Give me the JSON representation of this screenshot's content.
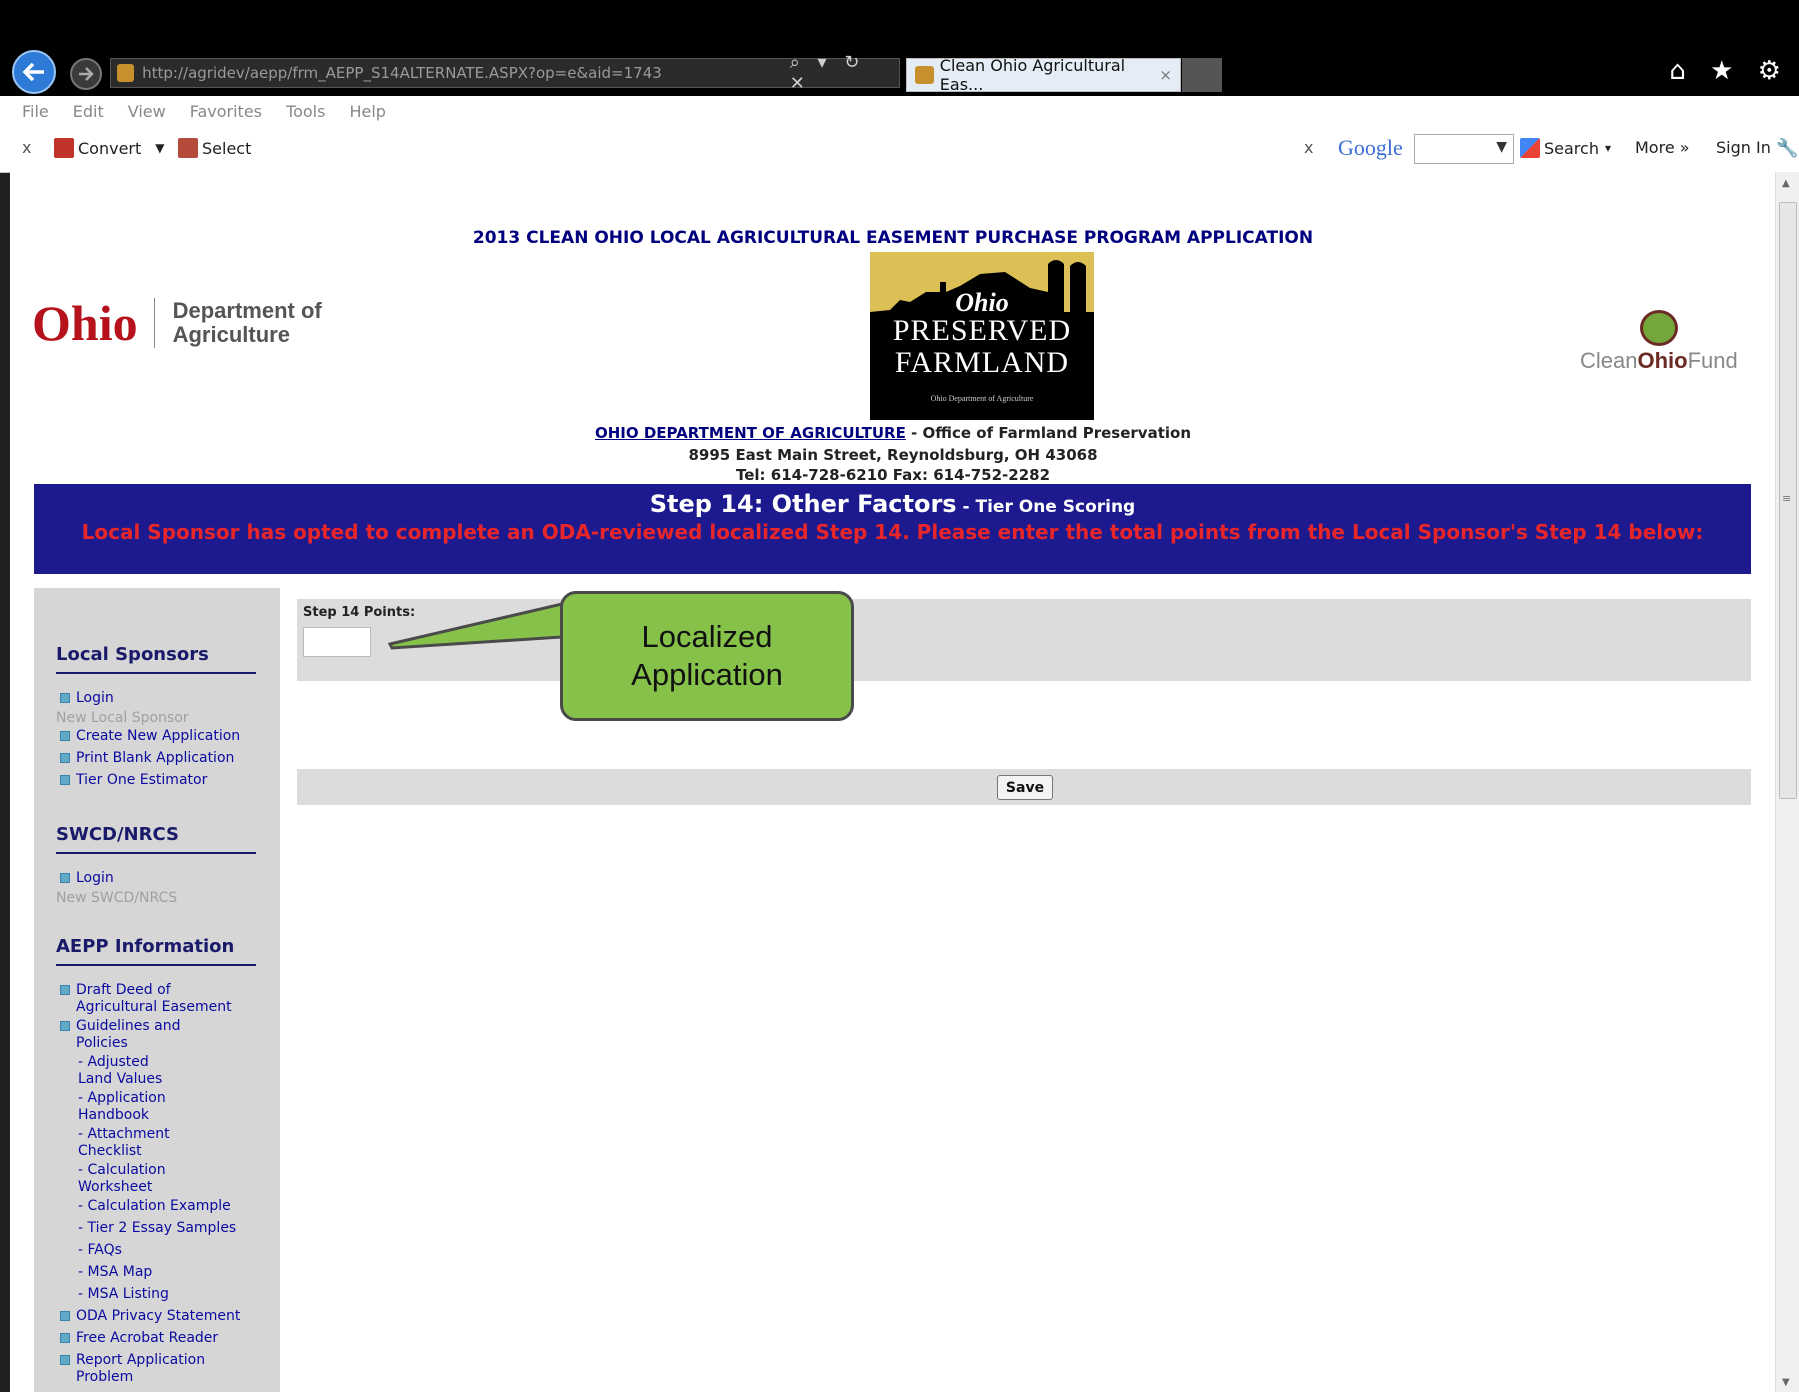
{
  "browser": {
    "url": "http://agridev/aepp/frm_AEPP_S14ALTERNATE.ASPX?op=e&aid=1743",
    "tab_title": "Clean Ohio Agricultural Eas...",
    "tab_close": "×",
    "address_controls": "⌕ ▾ ↻ ✕",
    "right_icons": "⌂ ★ ⚙",
    "menu": [
      "File",
      "Edit",
      "View",
      "Favorites",
      "Tools",
      "Help"
    ],
    "toolbar": {
      "close": "x",
      "convert_label": "Convert",
      "convert_arrow": "▼",
      "select_label": "Select",
      "google_close": "x",
      "google_label": "Google",
      "google_arrow": "▼",
      "search_label": "Search",
      "search_arrow": "▾",
      "more_label": "More »",
      "signin_label": "Sign In"
    }
  },
  "page": {
    "title": "2013 CLEAN OHIO LOCAL AGRICULTURAL EASEMENT PURCHASE PROGRAM APPLICATION",
    "oda_logo": {
      "ohio": "Ohio",
      "dept_line1": "Department of",
      "dept_line2": "Agriculture"
    },
    "farmland_logo": {
      "ohio": "Ohio",
      "line1": "PRESERVED",
      "line2": "FARMLAND",
      "small": "Ohio Department of Agriculture"
    },
    "cof_logo": {
      "clean": "Clean",
      "ohio": "Ohio",
      "fund": "Fund"
    },
    "office": {
      "link": "OHIO DEPARTMENT OF AGRICULTURE",
      "rest": " - Office of Farmland Preservation",
      "address": "8995 East Main Street, Reynoldsburg, OH  43068",
      "tel": "Tel: 614-728-6210 Fax: 614-752-2282"
    },
    "step": {
      "heading": "Step 14: Other Factors",
      "sub": " - Tier One Scoring",
      "message": "Local Sponsor has opted to complete an ODA-reviewed localized Step 14. Please enter the total points from the Local Sponsor's Step 14 below:"
    },
    "form": {
      "points_label": "Step 14 Points:",
      "points_value": "",
      "save": "Save"
    },
    "callout": {
      "line1": "Localized",
      "line2": "Application"
    }
  },
  "sidebar": {
    "local_sponsors": {
      "heading": "Local Sponsors",
      "login": "Login",
      "new_sponsor": "New Local Sponsor",
      "links": [
        "Create New Application",
        "Print Blank Application",
        "Tier One Estimator"
      ]
    },
    "swcd": {
      "heading": "SWCD/NRCS",
      "login": "Login",
      "new": "New SWCD/NRCS"
    },
    "aepp": {
      "heading": "AEPP Information",
      "draft_deed": [
        "Draft Deed of",
        "Agricultural Easement"
      ],
      "guidelines": [
        "Guidelines and",
        "Policies"
      ],
      "subs": [
        [
          "- Adjusted",
          "Land Values"
        ],
        [
          "- Application",
          "Handbook"
        ],
        [
          "- Attachment",
          "Checklist"
        ],
        [
          "- Calculation",
          "Worksheet"
        ],
        [
          "- Calculation Example"
        ],
        [
          "- Tier 2 Essay Samples"
        ],
        [
          "- FAQs"
        ],
        [
          "- MSA Map"
        ],
        [
          "- MSA Listing"
        ]
      ],
      "privacy": "ODA Privacy Statement",
      "acrobat": "Free Acrobat Reader",
      "report": [
        "Report Application",
        "Problem"
      ]
    }
  },
  "colors": {
    "banner": "#1c1a8e",
    "banner_message": "#e8262a",
    "callout": "#86c24a",
    "link": "#0a0aa0"
  }
}
